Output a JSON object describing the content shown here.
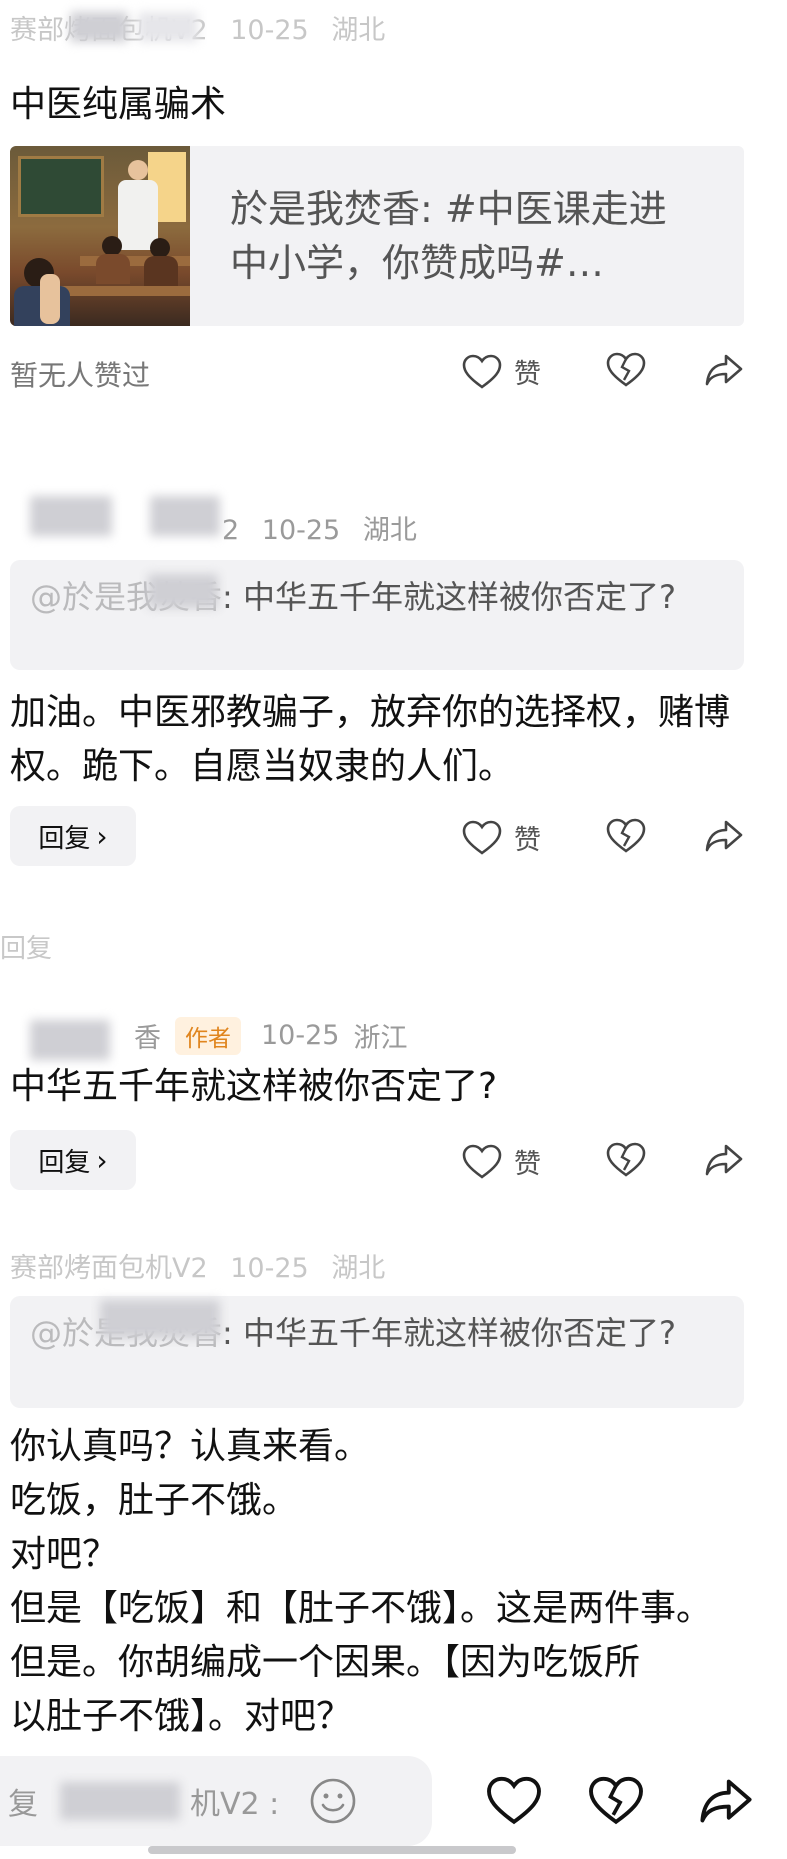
{
  "comment1": {
    "meta_name": "赛部烤面包机V2",
    "meta_date": "10-25",
    "meta_location": "湖北",
    "text": "中医纯属骗术",
    "card_text": "於是我焚香: #中医课走进中小学，你赞成吗#…",
    "no_likes": "暂无人赞过",
    "like_label": "赞"
  },
  "comment2": {
    "meta_suffix": "2",
    "meta_date": "10-25",
    "meta_location": "湖北",
    "quote_prefix": "@於是我焚香",
    "quote_text": "中华五千年就这样被你否定了?",
    "text": "加油。中医邪教骗子，放弃你的选择权，赌博权。跪下。自愿当奴隶的人们。",
    "reply_label": "回复",
    "like_label": "赞"
  },
  "divider_text": "回复",
  "comment3": {
    "meta_name_suffix": "香",
    "author_tag": "作者",
    "meta_date": "10-25",
    "meta_location": "浙江",
    "text": "中华五千年就这样被你否定了?",
    "reply_label": "回复",
    "like_label": "赞"
  },
  "comment4": {
    "meta_name": "赛部烤面包机V2",
    "meta_date": "10-25",
    "meta_location": "湖北",
    "quote_prefix": "@於是我焚香",
    "quote_text": "中华五千年就这样被你否定了?",
    "lines": [
      "你认真吗？认真来看。",
      "吃饭，肚子不饿。",
      "对吧？",
      "但是【吃饭】和【肚子不饿】。这是两件事。",
      "但是。你胡编成一个因果。【因为吃饭所",
      "以肚子不饿】。对吧？"
    ]
  },
  "input": {
    "placeholder_prefix": "复",
    "placeholder_suffix": "机V2 :"
  },
  "icons": {
    "like": "heart-icon",
    "dislike": "broken-heart-icon",
    "share": "share-arrow-icon",
    "emoji": "smiley-icon",
    "chevron": "chevron-right-icon"
  }
}
